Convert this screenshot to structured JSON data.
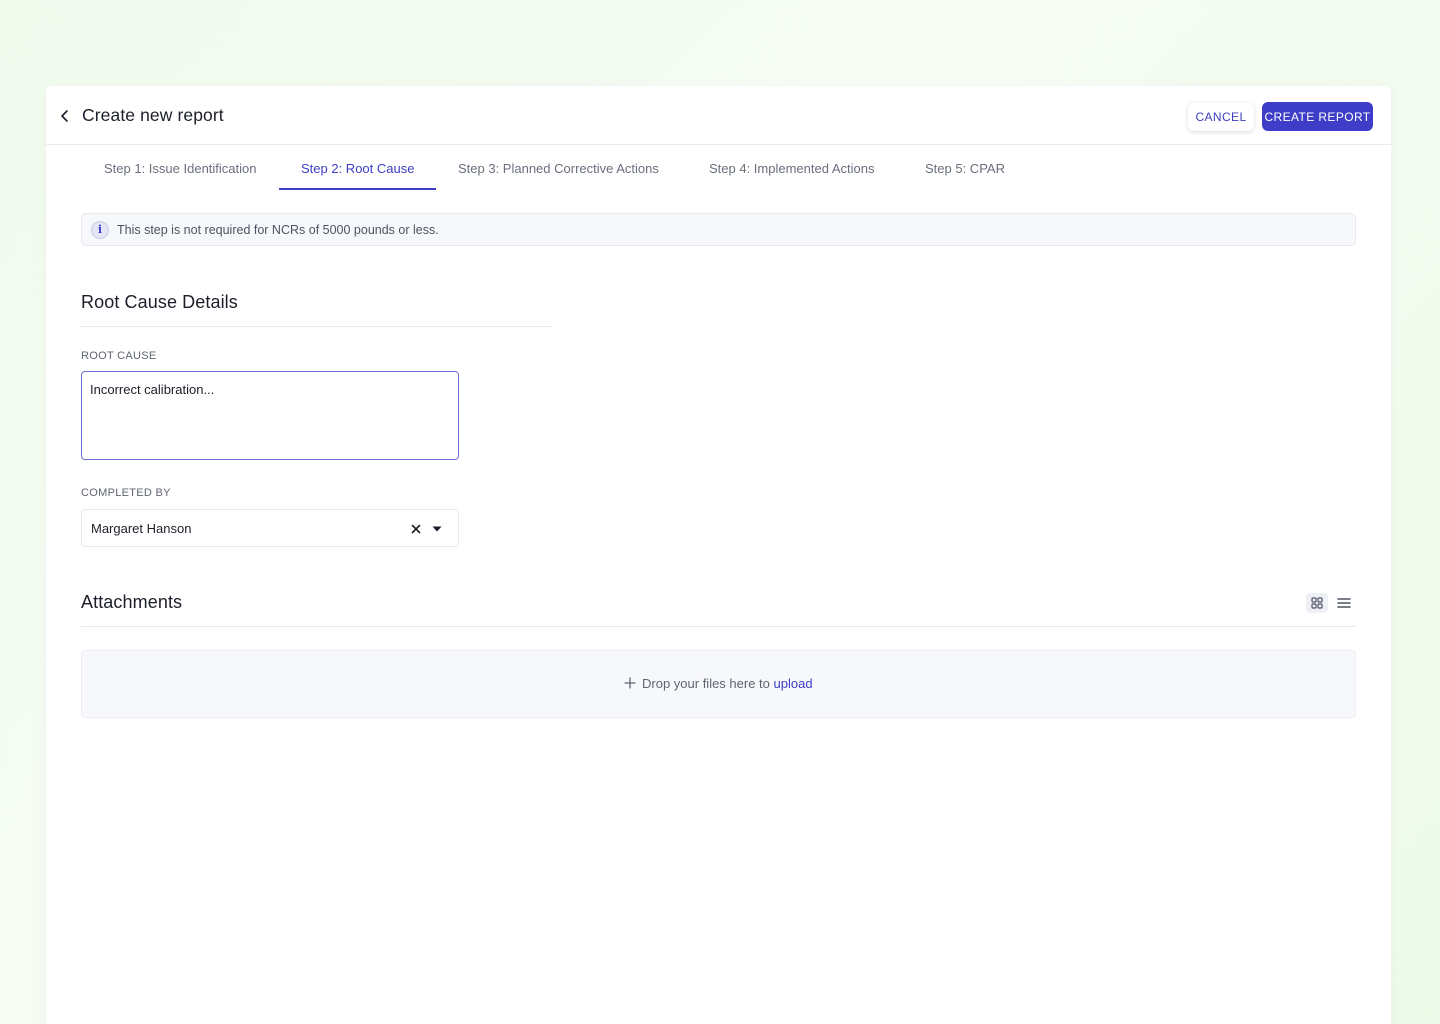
{
  "header": {
    "title": "Create new report",
    "cancel_label": "CANCEL",
    "create_label": "CREATE REPORT"
  },
  "tabs": [
    {
      "label": "Step 1: Issue Identification",
      "active": false
    },
    {
      "label": "Step 2: Root Cause",
      "active": true
    },
    {
      "label": "Step 3: Planned Corrective Actions",
      "active": false
    },
    {
      "label": "Step 4: Implemented Actions",
      "active": false
    },
    {
      "label": "Step 5: CPAR",
      "active": false
    }
  ],
  "info": {
    "text": "This step is not required for NCRs of 5000 pounds or less.",
    "icon": "info-icon"
  },
  "root_cause_section": {
    "title": "Root Cause Details",
    "root_cause_label": "ROOT CAUSE",
    "root_cause_value": "Incorrect calibration...",
    "completed_by_label": "COMPLETED BY",
    "completed_by_value": "Margaret Hanson"
  },
  "attachments": {
    "title": "Attachments",
    "drop_text": "Drop your files here to",
    "upload_label": "upload",
    "view_modes": [
      "grid-view-icon",
      "list-view-icon"
    ],
    "active_view": "grid"
  },
  "colors": {
    "accent": "#3d3dc8",
    "background": "#f1fbee",
    "muted_text": "#6a6f7d"
  }
}
